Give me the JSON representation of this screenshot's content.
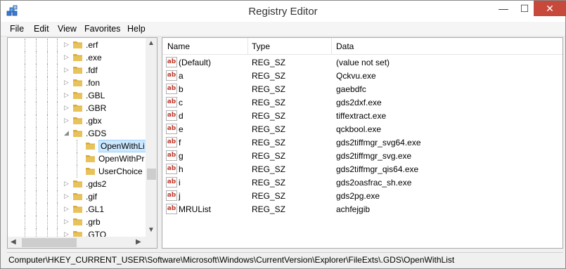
{
  "window": {
    "title": "Registry Editor",
    "minimize": "—",
    "maximize": "☐",
    "close": "✕"
  },
  "menu": [
    "File",
    "Edit",
    "View",
    "Favorites",
    "Help"
  ],
  "tree": [
    {
      "label": ".erf",
      "expander": "▷",
      "selected": false
    },
    {
      "label": ".exe",
      "expander": "▷",
      "selected": false
    },
    {
      "label": ".fdf",
      "expander": "▷",
      "selected": false
    },
    {
      "label": ".fon",
      "expander": "▷",
      "selected": false
    },
    {
      "label": ".GBL",
      "expander": "▷",
      "selected": false
    },
    {
      "label": ".GBR",
      "expander": "▷",
      "selected": false
    },
    {
      "label": ".gbx",
      "expander": "▷",
      "selected": false
    },
    {
      "label": ".GDS",
      "expander": "◢",
      "selected": false
    },
    {
      "label": "OpenWithLi",
      "expander": "",
      "selected": true
    },
    {
      "label": "OpenWithPr",
      "expander": "",
      "selected": false
    },
    {
      "label": "UserChoice",
      "expander": "",
      "selected": false
    },
    {
      "label": ".gds2",
      "expander": "▷",
      "selected": false
    },
    {
      "label": ".gif",
      "expander": "▷",
      "selected": false
    },
    {
      "label": ".GL1",
      "expander": "▷",
      "selected": false
    },
    {
      "label": ".grb",
      "expander": "▷",
      "selected": false
    },
    {
      "label": ".GTO",
      "expander": "▷",
      "selected": false
    }
  ],
  "list": {
    "columns": [
      "Name",
      "Type",
      "Data"
    ],
    "icon_text": "ab",
    "rows": [
      {
        "name": "(Default)",
        "type": "REG_SZ",
        "data": "(value not set)"
      },
      {
        "name": "a",
        "type": "REG_SZ",
        "data": "Qckvu.exe"
      },
      {
        "name": "b",
        "type": "REG_SZ",
        "data": "gaebdfc"
      },
      {
        "name": "c",
        "type": "REG_SZ",
        "data": "gds2dxf.exe"
      },
      {
        "name": "d",
        "type": "REG_SZ",
        "data": "tiffextract.exe"
      },
      {
        "name": "e",
        "type": "REG_SZ",
        "data": "qckbool.exe"
      },
      {
        "name": "f",
        "type": "REG_SZ",
        "data": "gds2tiffmgr_svg64.exe"
      },
      {
        "name": "g",
        "type": "REG_SZ",
        "data": "gds2tiffmgr_svg.exe"
      },
      {
        "name": "h",
        "type": "REG_SZ",
        "data": "gds2tiffmgr_qis64.exe"
      },
      {
        "name": "i",
        "type": "REG_SZ",
        "data": "gds2oasfrac_sh.exe"
      },
      {
        "name": "j",
        "type": "REG_SZ",
        "data": "gds2pg.exe"
      },
      {
        "name": "MRUList",
        "type": "REG_SZ",
        "data": "achfejgib"
      }
    ]
  },
  "status": "Computer\\HKEY_CURRENT_USER\\Software\\Microsoft\\Windows\\CurrentVersion\\Explorer\\FileExts\\.GDS\\OpenWithList",
  "colors": {
    "folder": "#e8c25a",
    "selection": "#cce8ff",
    "close_button": "#c7493c"
  }
}
